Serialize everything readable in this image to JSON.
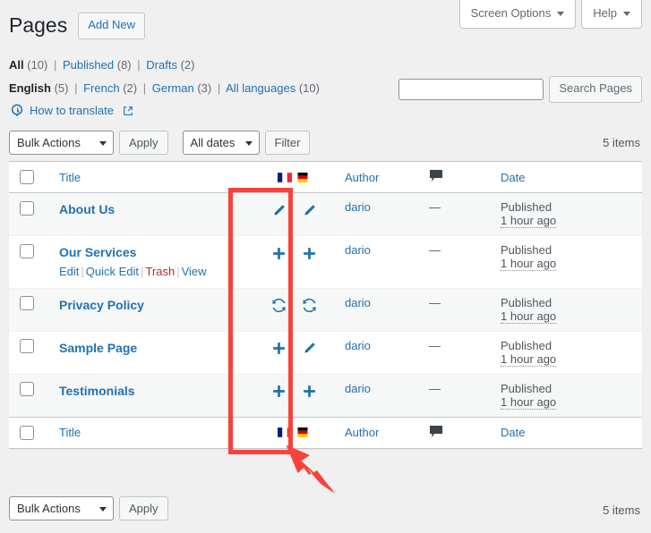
{
  "screen_meta": {
    "screen_options_label": "Screen Options",
    "help_label": "Help"
  },
  "header": {
    "title": "Pages",
    "add_new_label": "Add New"
  },
  "status_filters": [
    {
      "label": "All",
      "count": "(10)",
      "current": true
    },
    {
      "label": "Published",
      "count": "(8)",
      "current": false
    },
    {
      "label": "Drafts",
      "count": "(2)",
      "current": false
    }
  ],
  "language_filters": [
    {
      "label": "English",
      "count": "(5)",
      "current": true
    },
    {
      "label": "French",
      "count": "(2)",
      "current": false
    },
    {
      "label": "German",
      "count": "(3)",
      "current": false
    },
    {
      "label": "All languages",
      "count": "(10)",
      "current": false
    }
  ],
  "how_to_translate": {
    "label": "How to translate",
    "icon": "wpml-globe-icon",
    "external_icon": "external-link-icon"
  },
  "search": {
    "value": "",
    "placeholder": "",
    "button_label": "Search Pages"
  },
  "tablenav_top": {
    "bulk_actions_label": "Bulk Actions",
    "apply_label": "Apply",
    "date_filter_label": "All dates",
    "filter_label": "Filter",
    "items_count": "5 items"
  },
  "tablenav_bottom": {
    "bulk_actions_label": "Bulk Actions",
    "apply_label": "Apply",
    "items_count": "5 items"
  },
  "table": {
    "columns": {
      "title": "Title",
      "author": "Author",
      "comments_icon": "comment-bubble-icon",
      "date": "Date"
    },
    "language_columns": [
      {
        "name": "french-flag-icon",
        "label": "French"
      },
      {
        "name": "german-flag-icon",
        "label": "German"
      }
    ],
    "rows": [
      {
        "title": "About Us",
        "author": "dario",
        "comments": "—",
        "date_status": "Published",
        "date_relative": "1 hour ago",
        "translations": [
          {
            "icon": "edit-translation-pencil-icon",
            "lang": "French"
          },
          {
            "icon": "edit-translation-pencil-icon",
            "lang": "German"
          }
        ],
        "row_actions": []
      },
      {
        "title": "Our Services",
        "author": "dario",
        "comments": "—",
        "date_status": "Published",
        "date_relative": "1 hour ago",
        "translations": [
          {
            "icon": "add-translation-plus-icon",
            "lang": "French"
          },
          {
            "icon": "add-translation-plus-icon",
            "lang": "German"
          }
        ],
        "row_actions": [
          {
            "label": "Edit",
            "kind": "edit"
          },
          {
            "label": "Quick Edit",
            "kind": "quick-edit"
          },
          {
            "label": "Trash",
            "kind": "trash"
          },
          {
            "label": "View",
            "kind": "view"
          }
        ]
      },
      {
        "title": "Privacy Policy",
        "author": "dario",
        "comments": "—",
        "date_status": "Published",
        "date_relative": "1 hour ago",
        "translations": [
          {
            "icon": "update-translation-sync-icon",
            "lang": "French"
          },
          {
            "icon": "update-translation-sync-icon",
            "lang": "German"
          }
        ],
        "row_actions": []
      },
      {
        "title": "Sample Page",
        "author": "dario",
        "comments": "—",
        "date_status": "Published",
        "date_relative": "1 hour ago",
        "translations": [
          {
            "icon": "add-translation-plus-icon",
            "lang": "French"
          },
          {
            "icon": "edit-translation-pencil-icon",
            "lang": "German"
          }
        ],
        "row_actions": []
      },
      {
        "title": "Testimonials",
        "author": "dario",
        "comments": "—",
        "date_status": "Published",
        "date_relative": "1 hour ago",
        "translations": [
          {
            "icon": "add-translation-plus-icon",
            "lang": "French"
          },
          {
            "icon": "add-translation-plus-icon",
            "lang": "German"
          }
        ],
        "row_actions": []
      }
    ]
  },
  "annotation": {
    "highlight_color": "#f9423a",
    "shapes": [
      "highlight-rectangle",
      "pointer-arrow"
    ]
  },
  "colors": {
    "link": "#2271b1",
    "trash_link": "#b32d2e",
    "page_bg": "#f0f0f1",
    "row_alt_bg": "#f6f7f7",
    "border": "#c3c4c7"
  }
}
